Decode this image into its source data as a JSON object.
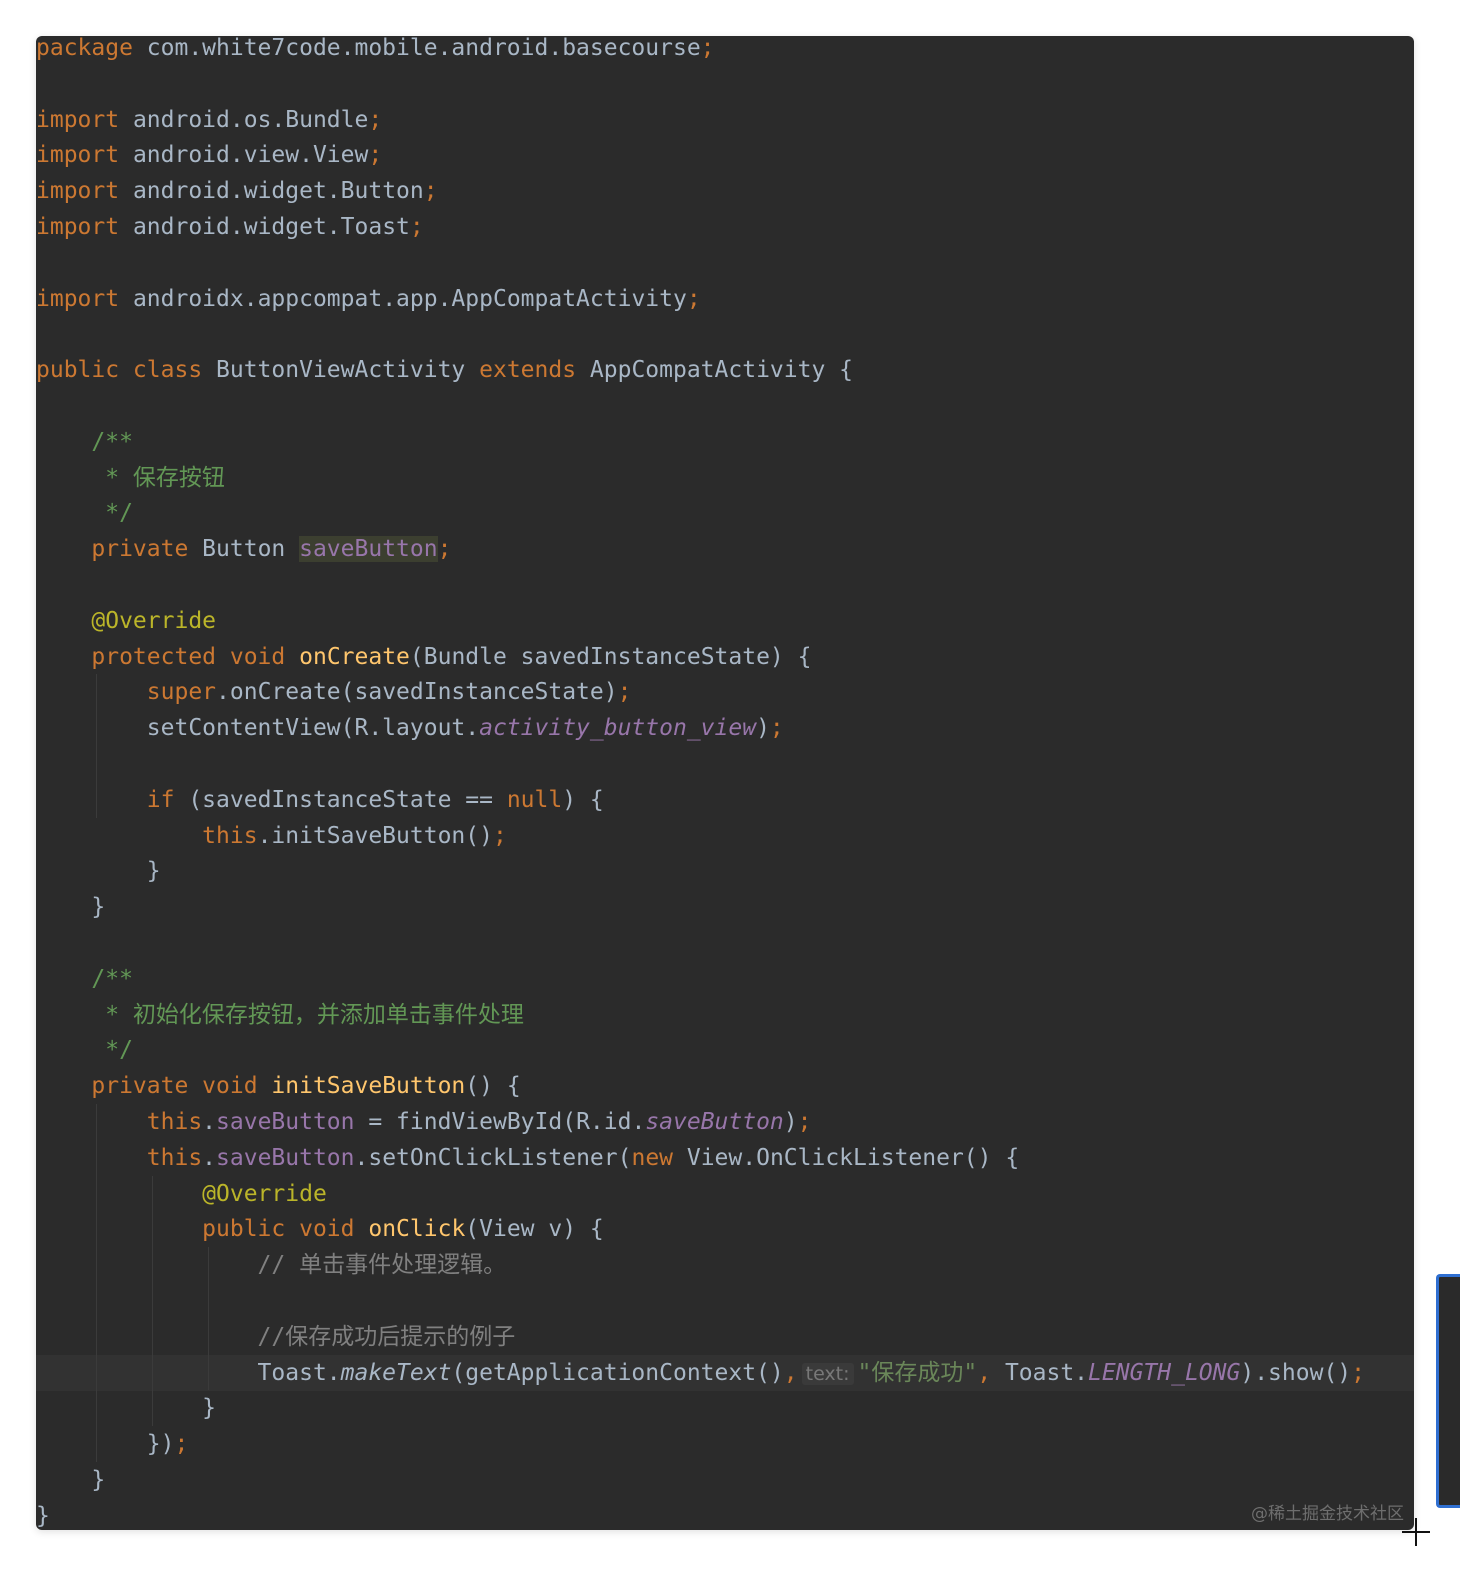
{
  "editor": {
    "theme_colors": {
      "background": "#2b2b2b",
      "keyword": "#cc7832",
      "text": "#a9b7c6",
      "doc_comment": "#629755",
      "line_comment": "#808080",
      "annotation": "#bbb529",
      "method_declaration": "#ffc66d",
      "field": "#9876aa",
      "string": "#6a8759"
    },
    "lines": [
      {
        "tokens": [
          {
            "t": "package",
            "c": "kw"
          },
          {
            "t": " com.white7code.mobile.android.basecourse",
            "c": "plain"
          },
          {
            "t": ";",
            "c": "semi"
          }
        ]
      },
      {
        "tokens": []
      },
      {
        "tokens": [
          {
            "t": "import",
            "c": "kw"
          },
          {
            "t": " android.os.Bundle",
            "c": "plain"
          },
          {
            "t": ";",
            "c": "semi"
          }
        ]
      },
      {
        "tokens": [
          {
            "t": "import",
            "c": "kw"
          },
          {
            "t": " android.view.View",
            "c": "plain"
          },
          {
            "t": ";",
            "c": "semi"
          }
        ]
      },
      {
        "tokens": [
          {
            "t": "import",
            "c": "kw"
          },
          {
            "t": " android.widget.Button",
            "c": "plain"
          },
          {
            "t": ";",
            "c": "semi"
          }
        ]
      },
      {
        "tokens": [
          {
            "t": "import",
            "c": "kw"
          },
          {
            "t": " android.widget.Toast",
            "c": "plain"
          },
          {
            "t": ";",
            "c": "semi"
          }
        ]
      },
      {
        "tokens": []
      },
      {
        "tokens": [
          {
            "t": "import",
            "c": "kw"
          },
          {
            "t": " androidx.appcompat.app.AppCompatActivity",
            "c": "plain"
          },
          {
            "t": ";",
            "c": "semi"
          }
        ]
      },
      {
        "tokens": []
      },
      {
        "tokens": [
          {
            "t": "public class",
            "c": "kw"
          },
          {
            "t": " ButtonViewActivity ",
            "c": "plain"
          },
          {
            "t": "extends",
            "c": "kw"
          },
          {
            "t": " AppCompatActivity {",
            "c": "plain"
          }
        ]
      },
      {
        "tokens": []
      },
      {
        "tokens": [
          {
            "t": "    /**",
            "c": "comment"
          }
        ]
      },
      {
        "tokens": [
          {
            "t": "     * 保存按钮",
            "c": "comment"
          }
        ]
      },
      {
        "tokens": [
          {
            "t": "     */",
            "c": "comment"
          }
        ]
      },
      {
        "tokens": [
          {
            "t": "    ",
            "c": "plain"
          },
          {
            "t": "private",
            "c": "kw"
          },
          {
            "t": " Button ",
            "c": "plain"
          },
          {
            "t": "saveButton",
            "c": "highlight"
          },
          {
            "t": ";",
            "c": "semi"
          }
        ]
      },
      {
        "tokens": []
      },
      {
        "tokens": [
          {
            "t": "    @Override",
            "c": "annot"
          }
        ]
      },
      {
        "tokens": [
          {
            "t": "    ",
            "c": "plain"
          },
          {
            "t": "protected void",
            "c": "kw"
          },
          {
            "t": " ",
            "c": "plain"
          },
          {
            "t": "onCreate",
            "c": "method-decl"
          },
          {
            "t": "(Bundle savedInstanceState) {",
            "c": "plain"
          }
        ]
      },
      {
        "tokens": [
          {
            "t": "        ",
            "c": "plain"
          },
          {
            "t": "super",
            "c": "kw"
          },
          {
            "t": ".onCreate(savedInstanceState)",
            "c": "plain"
          },
          {
            "t": ";",
            "c": "semi"
          }
        ]
      },
      {
        "tokens": [
          {
            "t": "        setContentView(R.layout.",
            "c": "plain"
          },
          {
            "t": "activity_button_view",
            "c": "static"
          },
          {
            "t": ")",
            "c": "plain"
          },
          {
            "t": ";",
            "c": "semi"
          }
        ]
      },
      {
        "tokens": []
      },
      {
        "tokens": [
          {
            "t": "        ",
            "c": "plain"
          },
          {
            "t": "if",
            "c": "kw"
          },
          {
            "t": " (savedInstanceState == ",
            "c": "plain"
          },
          {
            "t": "null",
            "c": "kw"
          },
          {
            "t": ") {",
            "c": "plain"
          }
        ]
      },
      {
        "tokens": [
          {
            "t": "            ",
            "c": "plain"
          },
          {
            "t": "this",
            "c": "kw"
          },
          {
            "t": ".initSaveButton()",
            "c": "plain"
          },
          {
            "t": ";",
            "c": "semi"
          }
        ]
      },
      {
        "tokens": [
          {
            "t": "        }",
            "c": "plain"
          }
        ]
      },
      {
        "tokens": [
          {
            "t": "    }",
            "c": "plain"
          }
        ]
      },
      {
        "tokens": []
      },
      {
        "tokens": [
          {
            "t": "    /**",
            "c": "comment"
          }
        ]
      },
      {
        "tokens": [
          {
            "t": "     * 初始化保存按钮，并添加单击事件处理",
            "c": "comment"
          }
        ]
      },
      {
        "tokens": [
          {
            "t": "     */",
            "c": "comment"
          }
        ]
      },
      {
        "tokens": [
          {
            "t": "    ",
            "c": "plain"
          },
          {
            "t": "private void",
            "c": "kw"
          },
          {
            "t": " ",
            "c": "plain"
          },
          {
            "t": "initSaveButton",
            "c": "method-decl"
          },
          {
            "t": "() {",
            "c": "plain"
          }
        ]
      },
      {
        "tokens": [
          {
            "t": "        ",
            "c": "plain"
          },
          {
            "t": "this",
            "c": "kw"
          },
          {
            "t": ".",
            "c": "plain"
          },
          {
            "t": "saveButton",
            "c": "field"
          },
          {
            "t": " = findViewById(R.id.",
            "c": "plain"
          },
          {
            "t": "saveButton",
            "c": "static"
          },
          {
            "t": ")",
            "c": "plain"
          },
          {
            "t": ";",
            "c": "semi"
          }
        ]
      },
      {
        "tokens": [
          {
            "t": "        ",
            "c": "plain"
          },
          {
            "t": "this",
            "c": "kw"
          },
          {
            "t": ".",
            "c": "plain"
          },
          {
            "t": "saveButton",
            "c": "field"
          },
          {
            "t": ".setOnClickListener(",
            "c": "plain"
          },
          {
            "t": "new",
            "c": "kw"
          },
          {
            "t": " View.OnClickListener() {",
            "c": "plain"
          }
        ]
      },
      {
        "tokens": [
          {
            "t": "            @Override",
            "c": "annot"
          }
        ]
      },
      {
        "tokens": [
          {
            "t": "            ",
            "c": "plain"
          },
          {
            "t": "public void",
            "c": "kw"
          },
          {
            "t": " ",
            "c": "plain"
          },
          {
            "t": "onClick",
            "c": "method-decl"
          },
          {
            "t": "(View v) {",
            "c": "plain"
          }
        ]
      },
      {
        "tokens": [
          {
            "t": "                // 单击事件处理逻辑。",
            "c": "line-comment"
          }
        ]
      },
      {
        "tokens": []
      },
      {
        "tokens": [
          {
            "t": "                //保存成功后提示的例子",
            "c": "line-comment"
          }
        ]
      },
      {
        "current": true,
        "tokens": [
          {
            "t": "                Toast.",
            "c": "plain"
          },
          {
            "t": "makeText",
            "c": "italic"
          },
          {
            "t": "(getApplicationContext()",
            "c": "plain"
          },
          {
            "t": ",",
            "c": "semi"
          },
          {
            "t": "text:",
            "c": "hint"
          },
          {
            "t": "\"保存成功\"",
            "c": "string"
          },
          {
            "t": ",",
            "c": "semi"
          },
          {
            "t": " Toast.",
            "c": "plain"
          },
          {
            "t": "LENGTH_LONG",
            "c": "static"
          },
          {
            "t": ").show()",
            "c": "plain"
          },
          {
            "t": ";",
            "c": "semi"
          }
        ]
      },
      {
        "tokens": [
          {
            "t": "            }",
            "c": "plain"
          }
        ]
      },
      {
        "tokens": [
          {
            "t": "        })",
            "c": "plain"
          },
          {
            "t": ";",
            "c": "semi"
          }
        ]
      },
      {
        "tokens": [
          {
            "t": "    }",
            "c": "plain"
          }
        ]
      },
      {
        "tokens": [
          {
            "t": "}",
            "c": "plain"
          }
        ]
      }
    ]
  },
  "watermark": "@稀土掘金技术社区"
}
